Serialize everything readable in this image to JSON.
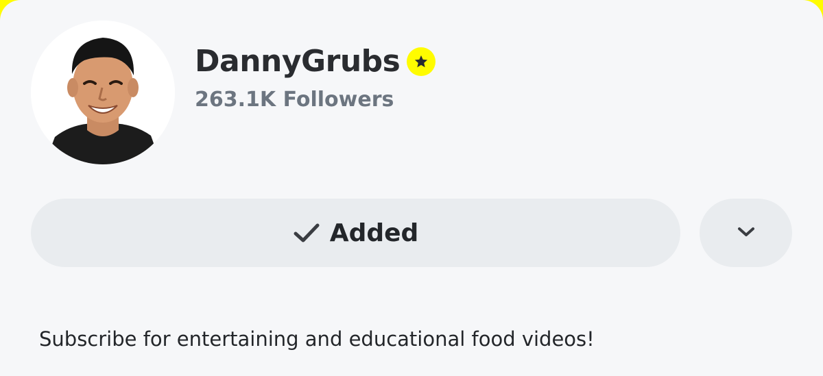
{
  "profile": {
    "name": "DannyGrubs",
    "followers": "263.1K Followers",
    "bio": "Subscribe for entertaining and educational food videos!"
  },
  "actions": {
    "added_label": "Added"
  },
  "icons": {
    "verified": "star-badge-icon",
    "added": "checkmark-icon",
    "more": "chevron-down-icon"
  },
  "colors": {
    "brand_yellow": "#FFFC00",
    "background": "#F6F7F9",
    "button_bg": "#E9ECEF",
    "text_primary": "#23262A",
    "text_secondary": "#6C7580"
  }
}
